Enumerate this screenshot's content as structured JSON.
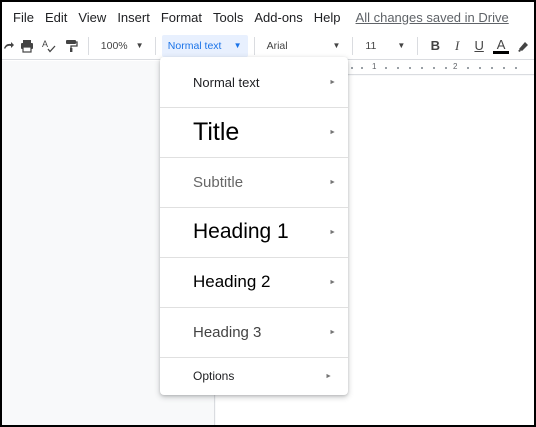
{
  "menubar": {
    "items": [
      "File",
      "Edit",
      "View",
      "Insert",
      "Format",
      "Tools",
      "Add-ons",
      "Help"
    ],
    "saved_status": "All changes saved in Drive"
  },
  "toolbar": {
    "icons": [
      "redo-icon",
      "print-icon",
      "spellcheck-icon",
      "paint-format-icon"
    ],
    "zoom": "100%",
    "style": "Normal text",
    "font": "Arial",
    "font_size": "11",
    "format_icons": [
      "bold-icon",
      "italic-icon",
      "underline-icon",
      "text-color-icon",
      "highlight-icon"
    ],
    "text_color": "#000000",
    "accent": "#1a73e8"
  },
  "ruler": {
    "marks": [
      "1",
      "2"
    ]
  },
  "style_menu": {
    "items": [
      {
        "label": "Normal text"
      },
      {
        "label": "Title"
      },
      {
        "label": "Subtitle"
      },
      {
        "label": "Heading 1"
      },
      {
        "label": "Heading 2"
      },
      {
        "label": "Heading 3"
      },
      {
        "label": "Options"
      }
    ],
    "submenu_arrow": "►"
  }
}
